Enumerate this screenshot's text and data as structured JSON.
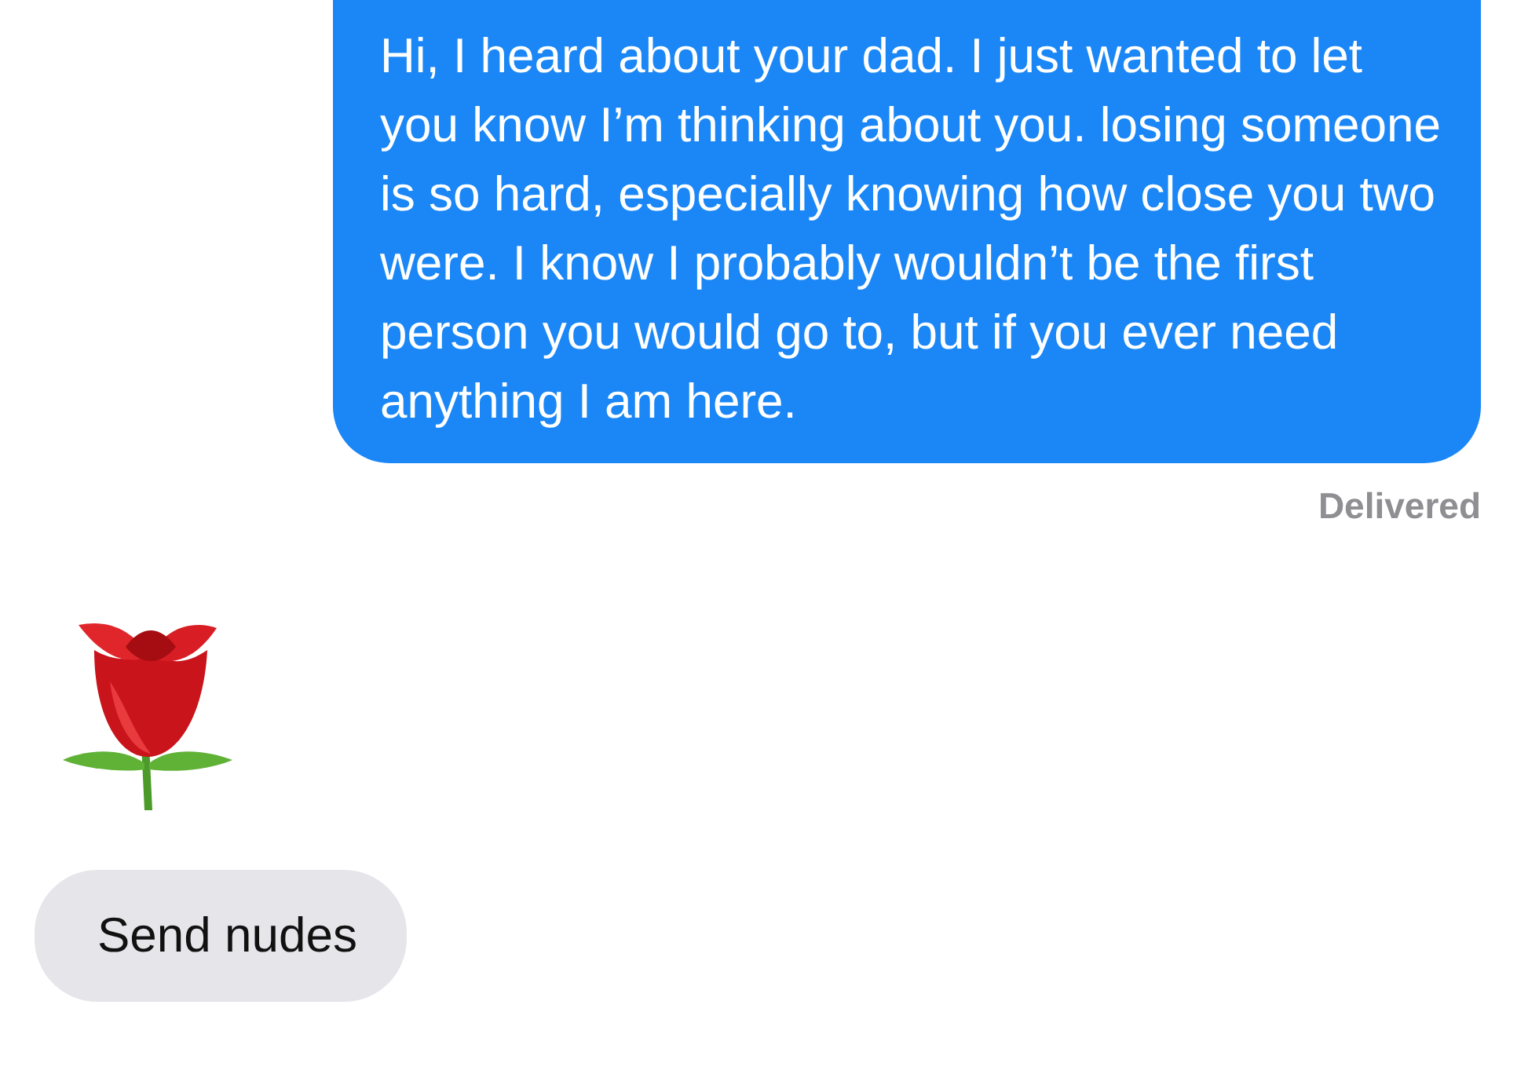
{
  "messages": [
    {
      "kind": "outgoing",
      "text": "Hi, I heard about your dad. I just wanted to let you know I’m thinking about you. losing someone is so hard, especially knowing how close you two were. I know I probably wouldn’t be the first person you would go to, but if you ever need anything I am here.",
      "status": "Delivered"
    },
    {
      "kind": "emoji"
    },
    {
      "kind": "incoming",
      "text": "Send nudes"
    }
  ]
}
